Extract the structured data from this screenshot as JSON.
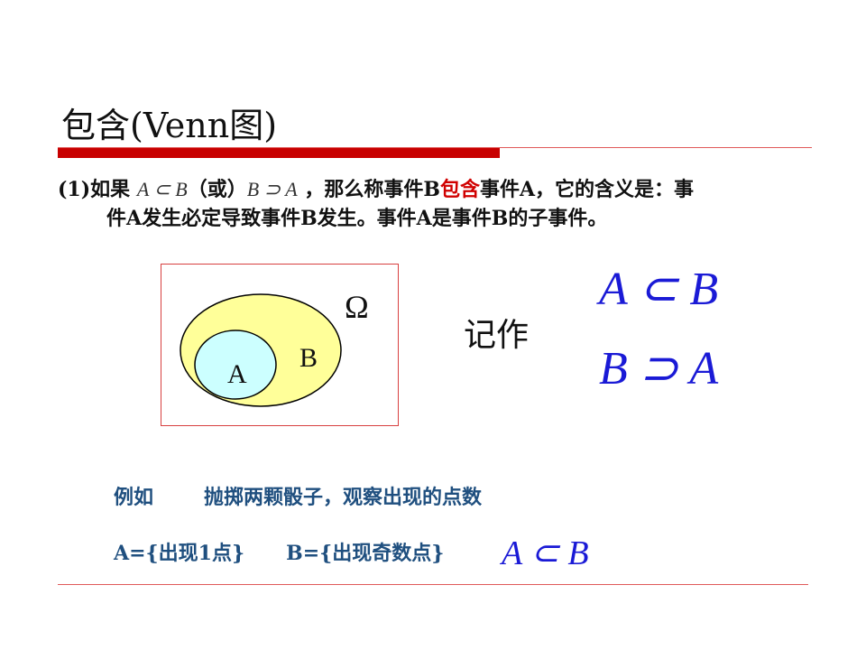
{
  "title": "包含(Venn图)",
  "paragraph": {
    "marker": "(1)如果",
    "expr1": "A ⊂ B",
    "or_text": "（或）",
    "expr2": "B ⊃ A",
    "part1": "，那么称事件B",
    "highlight": "包含",
    "part2": "事件A，它的含义是：事",
    "line2": "件A发生必定导致事件B发生。事件A是事件B的子事件。"
  },
  "venn": {
    "omega": "Ω",
    "label_a": "A",
    "label_b": "B",
    "colors": {
      "outer_fill": "#ffff99",
      "inner_fill": "#ccffff",
      "border": "#d84040"
    }
  },
  "notation": {
    "label": "记作",
    "expr1": "A ⊂ B",
    "expr2": "B ⊃ A"
  },
  "example": {
    "label": "例如",
    "text": "抛掷两颗骰子，观察出现的点数"
  },
  "sets": {
    "a": "A={出现1点}",
    "b": "B={出现奇数点}",
    "relation": "A ⊂ B"
  },
  "colors": {
    "accent_red": "#c80000",
    "text_blue": "#1f4f7f",
    "math_blue": "#1a1ad6"
  }
}
